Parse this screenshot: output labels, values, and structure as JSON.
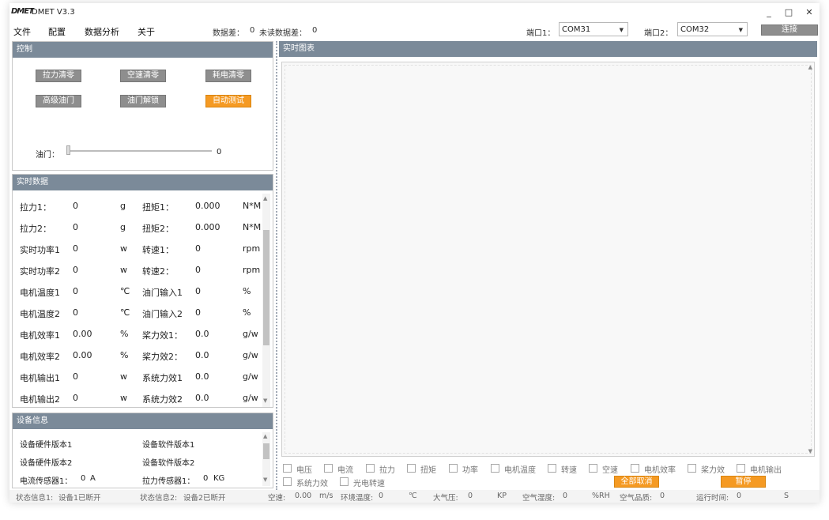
{
  "window": {
    "logo_text": "DMET",
    "title": "DMET V3.3",
    "min_glyph": "_",
    "max_glyph": "□",
    "close_glyph": "✕"
  },
  "menu": {
    "file": "文件",
    "config": "配置",
    "analysis": "数据分析",
    "about": "关于"
  },
  "header": {
    "data_diff_label": "数据差：",
    "data_diff_value": "0",
    "unread_label": "未读数据差：",
    "unread_value": "0",
    "port1_label": "端口1：",
    "port1_value": "COM31",
    "port2_label": "端口2：",
    "port2_value": "COM32",
    "connect_label": "连接"
  },
  "control": {
    "title": "控制",
    "buttons": [
      "拉力清零",
      "空速清零",
      "耗电清零",
      "高级油门",
      "油门解锁",
      "自动测试"
    ],
    "throttle_label": "油门：",
    "throttle_value": "0",
    "throttle_fraction": 0.0
  },
  "realtime": {
    "title": "实时数据",
    "rows": [
      {
        "l1": "拉力1：",
        "v1": "0",
        "u1": "g",
        "l2": "扭矩1：",
        "v2": "0.000",
        "u2": "N*M"
      },
      {
        "l1": "拉力2：",
        "v1": "0",
        "u1": "g",
        "l2": "扭矩2：",
        "v2": "0.000",
        "u2": "N*M"
      },
      {
        "l1": "实时功率1",
        "v1": "0",
        "u1": "w",
        "l2": "转速1：",
        "v2": "0",
        "u2": "rpm"
      },
      {
        "l1": "实时功率2",
        "v1": "0",
        "u1": "w",
        "l2": "转速2：",
        "v2": "0",
        "u2": "rpm"
      },
      {
        "l1": "电机温度1",
        "v1": "0",
        "u1": "℃",
        "l2": "油门输入1",
        "v2": "0",
        "u2": "%"
      },
      {
        "l1": "电机温度2",
        "v1": "0",
        "u1": "℃",
        "l2": "油门输入2",
        "v2": "0",
        "u2": "%"
      },
      {
        "l1": "电机效率1",
        "v1": "0.00",
        "u1": "%",
        "l2": "桨力效1：",
        "v2": "0.0",
        "u2": "g/w"
      },
      {
        "l1": "电机效率2",
        "v1": "0.00",
        "u1": "%",
        "l2": "桨力效2：",
        "v2": "0.0",
        "u2": "g/w"
      },
      {
        "l1": "电机输出1",
        "v1": "0",
        "u1": "w",
        "l2": "系统力效1",
        "v2": "0.0",
        "u2": "g/w"
      },
      {
        "l1": "电机输出2",
        "v1": "0",
        "u1": "w",
        "l2": "系统力效2",
        "v2": "0.0",
        "u2": "g/w"
      }
    ]
  },
  "device": {
    "title": "设备信息",
    "hw1": "设备硬件版本1",
    "sw1": "设备软件版本1",
    "hw2": "设备硬件版本2",
    "sw2": "设备软件版本2",
    "cur_sensor_label": "电流传感器1：",
    "cur_sensor_value": "0",
    "cur_sensor_unit": "A",
    "pull_sensor_label": "拉力传感器1：",
    "pull_sensor_value": "0",
    "pull_sensor_unit": "KG"
  },
  "chart": {
    "title": "实时图表",
    "checks_row1": [
      "电压",
      "电流",
      "拉力",
      "扭矩",
      "功率",
      "电机温度",
      "转速",
      "空速",
      "电机效率",
      "桨力效",
      "电机输出"
    ],
    "checks_row2": [
      "系统力效",
      "光电转速"
    ],
    "cancel_all": "全部取消",
    "pause": "暂停"
  },
  "statusbar": {
    "s1_label": "状态信息1:",
    "s1_value": "设备1已断开",
    "s2_label": "状态信息2:",
    "s2_value": "设备2已断开",
    "airspeed_label": "空速:",
    "airspeed_value": "0.00",
    "airspeed_unit": "m/s",
    "temp_label": "环境温度:",
    "temp_value": "0",
    "temp_unit": "℃",
    "pressure_label": "大气压:",
    "pressure_value": "0",
    "pressure_unit": "KP",
    "humidity_label": "空气湿度:",
    "humidity_value": "0",
    "humidity_unit": "%RH",
    "quality_label": "空气品质:",
    "quality_value": "0",
    "runtime_label": "运行时间:",
    "runtime_value": "0",
    "runtime_unit": "S"
  }
}
